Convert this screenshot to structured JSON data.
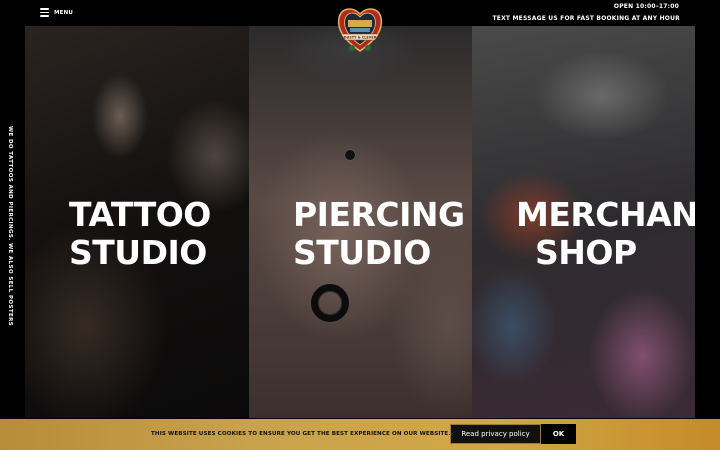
{
  "header": {
    "menu_label": "MENU",
    "hours": "OPEN 10:00–17:00",
    "sms_cta": "TEXT MESSAGE US FOR FAST BOOKING AT ANY HOUR",
    "logo_icon": "heart-anchor-logo",
    "logo_text": "DUSTY & CLEVER"
  },
  "side": {
    "tagline": "WE DO TATTOOS AND PIERCINGS. WE ALSO SELL POSTERS"
  },
  "panels": [
    {
      "line1": "TATTOO",
      "line2": "STUDIO"
    },
    {
      "line1": "PIERCING",
      "line2": "STUDIO"
    },
    {
      "line1": "MERCHAN",
      "line2": "SHOP"
    }
  ],
  "cookie": {
    "message": "THIS WEBSITE USES COOKIES TO ENSURE YOU GET THE BEST EXPERIENCE ON OUR WEBSITE.",
    "privacy_label": "Read privacy policy",
    "ok_label": "OK"
  },
  "colors": {
    "background": "#000000",
    "cookie_bar": "#c9a24d",
    "text": "#ffffff"
  }
}
